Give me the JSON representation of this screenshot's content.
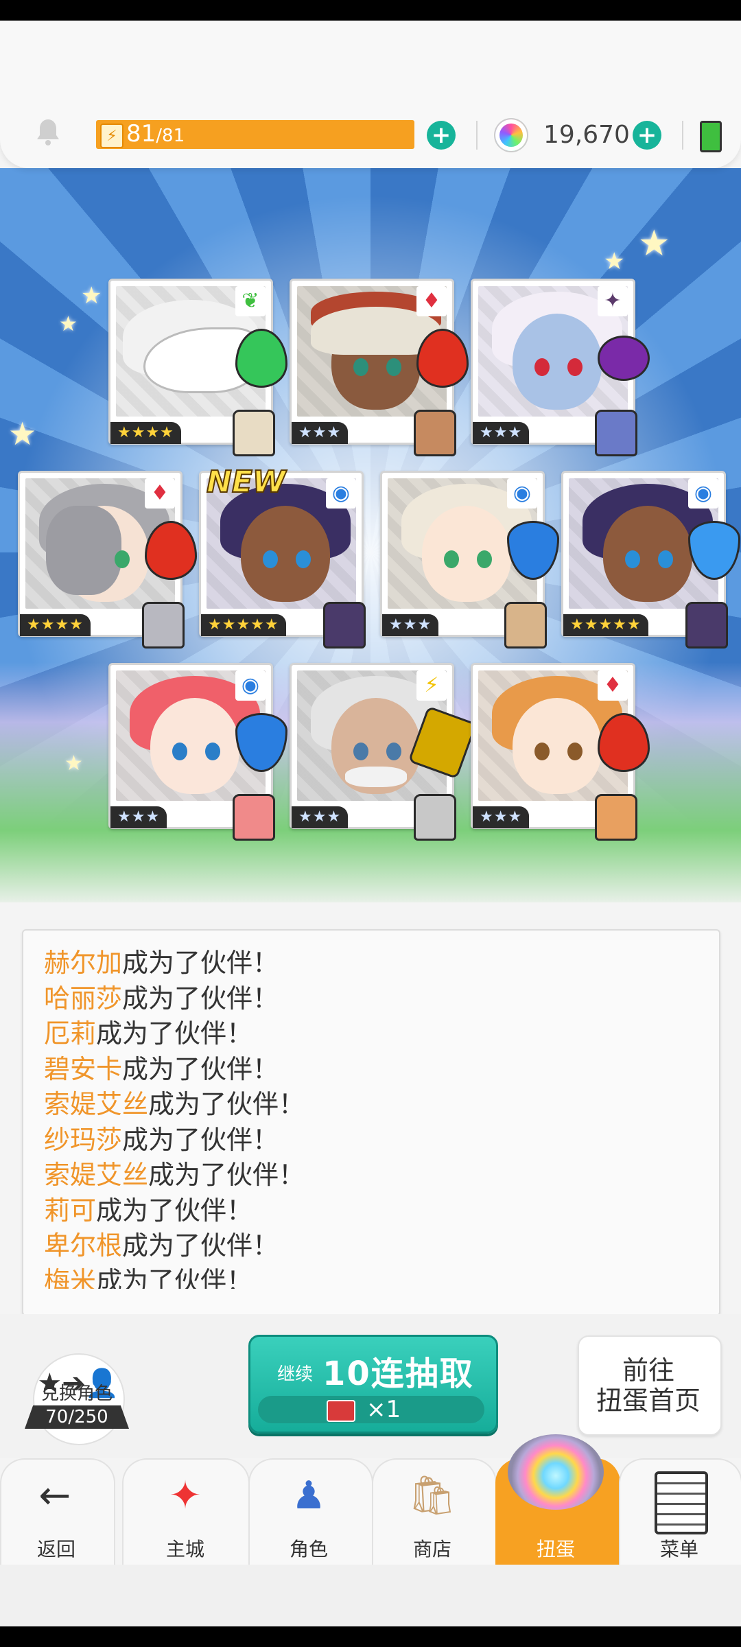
{
  "header": {
    "stamina_current": "81",
    "stamina_max": "/81",
    "gems": "19,670"
  },
  "cards": [
    {
      "stars": "★★★★",
      "element_icon": "leaf-icon",
      "new": false
    },
    {
      "stars": "★★★",
      "element_icon": "fire-diamond-icon",
      "new": false
    },
    {
      "stars": "★★★",
      "element_icon": "dark-icon",
      "new": false
    },
    {
      "stars": "★★★★",
      "element_icon": "fire-diamond-icon",
      "new": false
    },
    {
      "stars": "★★★★★",
      "element_icon": "water-icon",
      "new": true,
      "new_label": "NEW"
    },
    {
      "stars": "★★★",
      "element_icon": "water-icon",
      "new": false
    },
    {
      "stars": "★★★★★",
      "element_icon": "water-icon",
      "new": false
    },
    {
      "stars": "★★★",
      "element_icon": "water-icon",
      "new": false
    },
    {
      "stars": "★★★",
      "element_icon": "lightning-icon",
      "new": false
    },
    {
      "stars": "★★★",
      "element_icon": "fire-diamond-icon",
      "new": false
    }
  ],
  "log": {
    "suffix": "成为了伙伴！",
    "entries": [
      {
        "name": "赫尔加"
      },
      {
        "name": "哈丽莎"
      },
      {
        "name": "厄莉"
      },
      {
        "name": "碧安卡"
      },
      {
        "name": "索媞艾丝"
      },
      {
        "name": "纱玛莎"
      },
      {
        "name": "索媞艾丝"
      },
      {
        "name": "莉可"
      },
      {
        "name": "卑尔根"
      },
      {
        "name": "梅米"
      }
    ]
  },
  "actions": {
    "exchange_label": "兑换角色",
    "exchange_count": "70/250",
    "pull_prefix": "继续",
    "pull_label": "10连抽取",
    "pull_cost": "×1",
    "goto_line1": "前往",
    "goto_line2": "扭蛋首页"
  },
  "nav": {
    "back": "返回",
    "city": "主城",
    "character": "角色",
    "shop": "商店",
    "gacha": "扭蛋",
    "menu": "菜单"
  },
  "colors": {
    "accent_teal": "#17b49a",
    "stamina_orange": "#f6a020",
    "name_orange": "#f0952a",
    "gacha_tab": "#f7a122"
  }
}
